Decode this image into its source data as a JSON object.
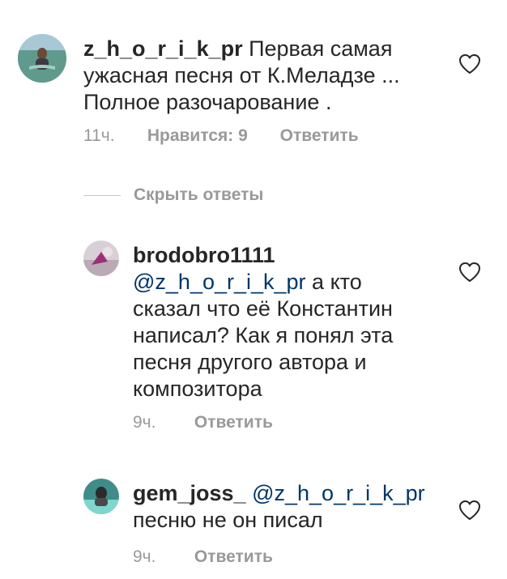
{
  "comments": [
    {
      "username": "z_h_o_r_i_k_pr",
      "text_lines": [
        " Первая самая",
        "ужасная песня от К.Меладзе ...",
        "Полное разочарование ."
      ],
      "time": "11ч.",
      "likes": "Нравится: 9",
      "reply": "Ответить"
    },
    {
      "username": "brodobro1111",
      "mention": "@z_h_o_r_i_k_pr",
      "text_lines": [
        " а кто",
        "сказал что её Константин",
        "написал? Как я понял эта",
        "песня другого автора и",
        "композитора"
      ],
      "time": "9ч.",
      "reply": "Ответить"
    },
    {
      "username": "gem_joss_",
      "mention": "@z_h_o_r_i_k_pr",
      "text_lines": [
        "песню не он писал"
      ],
      "time": "9ч.",
      "reply": "Ответить"
    }
  ],
  "hide_replies": "Скрыть ответы",
  "icons": {
    "heart": "heart-icon",
    "avatar": "avatar"
  },
  "colors": {
    "text": "#262626",
    "muted": "#999999",
    "mention": "#003569"
  }
}
